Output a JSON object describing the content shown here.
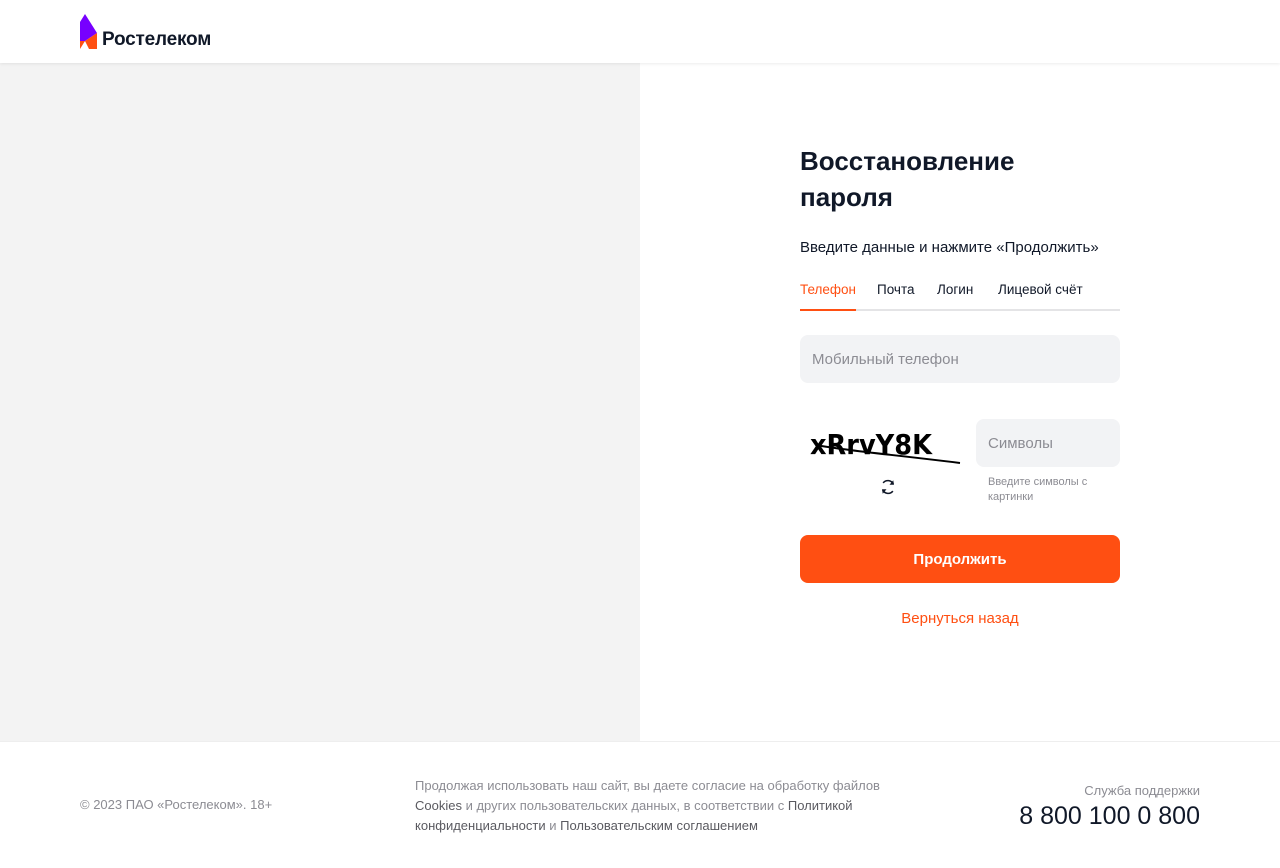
{
  "header": {
    "logo_text": "Ростелеком",
    "brand_colors": {
      "purple": "#7700ff",
      "orange": "#ff4f12"
    }
  },
  "form": {
    "title_line1": "Восстановление",
    "title_line2": "пароля",
    "subtitle": "Введите данные и нажмите «Продолжить»",
    "tabs": [
      {
        "label": "Телефон",
        "active": true
      },
      {
        "label": "Почта",
        "active": false
      },
      {
        "label": "Логин",
        "active": false
      },
      {
        "label": "Лицевой счёт",
        "active": false
      }
    ],
    "phone_placeholder": "Мобильный телефон",
    "captcha_text": "xRrvY8K",
    "captcha_placeholder": "Символы",
    "captcha_hint": "Введите символы с картинки",
    "continue_label": "Продолжить",
    "back_label": "Вернуться назад",
    "refresh_icon": "refresh-icon"
  },
  "footer": {
    "copyright": "© 2023 ПАО «Ростелеком». 18+",
    "legal_part1": "Продолжая использовать наш сайт, вы даете согласие на обработку файлов ",
    "legal_cookies": "Cookies",
    "legal_part2": " и других пользовательских данных, в соответствии с ",
    "legal_privacy": "Политикой конфиденциальности",
    "legal_part3": " и ",
    "legal_agreement": "Пользовательским соглашением",
    "support_label": "Служба поддержки",
    "support_phone": "8 800 100 0 800"
  },
  "colors": {
    "accent": "#ff4f12",
    "text": "#101828",
    "muted": "#8c8c93",
    "panel": "#f3f3f3",
    "input_bg": "#f2f3f5"
  }
}
